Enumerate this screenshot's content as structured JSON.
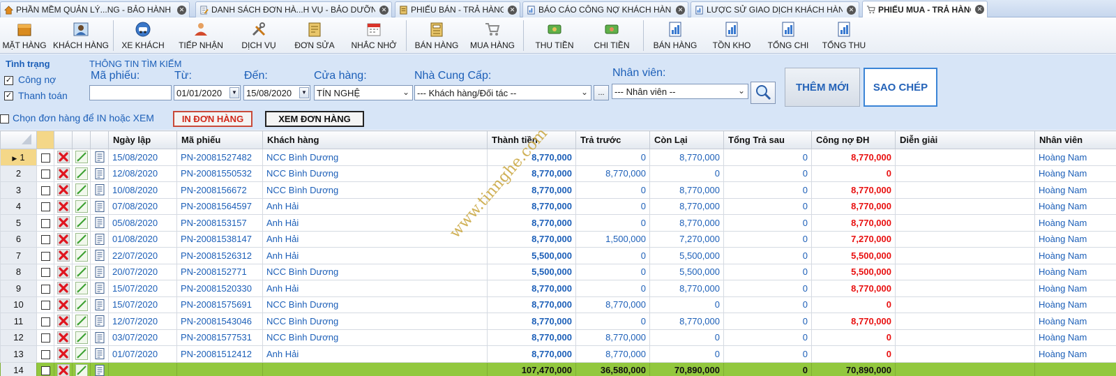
{
  "tabs": [
    {
      "label": "PHẦN MỀM QUẢN LÝ...NG - BẢO HÀNH XE",
      "icon": "home-icon",
      "active": false
    },
    {
      "label": "DANH SÁCH ĐƠN HÀ...H VỤ - BẢO DƯỠNG",
      "icon": "document-edit-icon",
      "active": false
    },
    {
      "label": "PHIẾU BÁN - TRẢ HÀNG",
      "icon": "invoice-icon",
      "active": false
    },
    {
      "label": "BÁO CÁO CÔNG NỢ KHÁCH HÀNG",
      "icon": "report-icon",
      "active": false
    },
    {
      "label": "LƯỢC SỬ GIAO DỊCH KHÁCH HÀNG",
      "icon": "report-icon",
      "active": false
    },
    {
      "label": "PHIẾU MUA - TRẢ HÀNG",
      "icon": "shopping-cart-icon",
      "active": true
    }
  ],
  "toolbar": [
    {
      "label": "MẶT HÀNG",
      "icon": "product-box-icon"
    },
    {
      "label": "KHÁCH HÀNG",
      "icon": "customer-icon"
    },
    {
      "label": "XE KHÁCH",
      "icon": "vehicle-icon"
    },
    {
      "label": "TIẾP NHẬN",
      "icon": "receptionist-icon"
    },
    {
      "label": "DỊCH VỤ",
      "icon": "tools-icon"
    },
    {
      "label": "ĐƠN SỬA",
      "icon": "repair-order-icon"
    },
    {
      "label": "NHẮC NHỞ",
      "icon": "calendar-icon"
    },
    {
      "label": "BÁN HÀNG",
      "icon": "cash-register-icon"
    },
    {
      "label": "MUA HÀNG",
      "icon": "shopping-cart-icon"
    },
    {
      "label": "THU TIỀN",
      "icon": "money-in-icon"
    },
    {
      "label": "CHI TIỀN",
      "icon": "money-out-icon"
    },
    {
      "label": "BÁN HÀNG",
      "icon": "sales-report-icon"
    },
    {
      "label": "TỒN KHO",
      "icon": "inventory-report-icon"
    },
    {
      "label": "TỔNG CHI",
      "icon": "expense-report-icon"
    },
    {
      "label": "TỔNG THU",
      "icon": "income-report-icon"
    }
  ],
  "status": {
    "title": "Tình trạng",
    "cong_no": {
      "label": "Công nợ",
      "checked": true
    },
    "thanh_toan": {
      "label": "Thanh toán",
      "checked": true
    }
  },
  "search": {
    "section_title": "THÔNG TIN TÌM KIẾM",
    "ma_phieu_label": "Mã phiếu:",
    "ma_phieu_value": "",
    "tu_label": "Từ:",
    "tu_value": "01/01/2020",
    "den_label": "Đến:",
    "den_value": "15/08/2020",
    "cua_hang_label": "Cửa hàng:",
    "cua_hang_value": "TÍN NGHỆ",
    "nha_cung_cap_label": "Nhà Cung Cấp:",
    "nha_cung_cap_value": "--- Khách hàng/Đối tác --",
    "nha_cung_cap_more": "...",
    "nhan_vien_label": "Nhân viên:",
    "nhan_vien_value": "--- Nhân viên --"
  },
  "buttons": {
    "them_moi": "THÊM MỚI",
    "sao_chep": "SAO CHÉP",
    "in_don_hang": "IN ĐƠN HÀNG",
    "xem_don_hang": "XEM ĐƠN HÀNG"
  },
  "select_print": {
    "label": "Chọn đơn hàng để IN hoặc XEM",
    "checked": false
  },
  "grid": {
    "headers": [
      "Ngày lập",
      "Mã phiếu",
      "Khách hàng",
      "Thành tiền",
      "Trả trước",
      "Còn Lại",
      "Tổng Trả sau",
      "Công nợ ĐH",
      "Diễn giải",
      "Nhân viên"
    ],
    "rows": [
      {
        "n": "1",
        "date": "15/08/2020",
        "code": "PN-20081527482",
        "customer": "NCC Bình Dương",
        "total": "8,770,000",
        "prepaid": "0",
        "remain": "8,770,000",
        "later": "0",
        "debt": "8,770,000",
        "note": "",
        "staff": "Hoàng Nam"
      },
      {
        "n": "2",
        "date": "12/08/2020",
        "code": "PN-20081550532",
        "customer": "NCC Bình Dương",
        "total": "8,770,000",
        "prepaid": "8,770,000",
        "remain": "0",
        "later": "0",
        "debt": "0",
        "note": "",
        "staff": "Hoàng Nam"
      },
      {
        "n": "3",
        "date": "10/08/2020",
        "code": "PN-2008156672",
        "customer": "NCC Bình Dương",
        "total": "8,770,000",
        "prepaid": "0",
        "remain": "8,770,000",
        "later": "0",
        "debt": "8,770,000",
        "note": "",
        "staff": "Hoàng Nam"
      },
      {
        "n": "4",
        "date": "07/08/2020",
        "code": "PN-20081564597",
        "customer": "Anh Hải",
        "total": "8,770,000",
        "prepaid": "0",
        "remain": "8,770,000",
        "later": "0",
        "debt": "8,770,000",
        "note": "",
        "staff": "Hoàng Nam"
      },
      {
        "n": "5",
        "date": "05/08/2020",
        "code": "PN-2008153157",
        "customer": "Anh Hải",
        "total": "8,770,000",
        "prepaid": "0",
        "remain": "8,770,000",
        "later": "0",
        "debt": "8,770,000",
        "note": "",
        "staff": "Hoàng Nam"
      },
      {
        "n": "6",
        "date": "01/08/2020",
        "code": "PN-20081538147",
        "customer": "Anh Hải",
        "total": "8,770,000",
        "prepaid": "1,500,000",
        "remain": "7,270,000",
        "later": "0",
        "debt": "7,270,000",
        "note": "",
        "staff": "Hoàng Nam"
      },
      {
        "n": "7",
        "date": "22/07/2020",
        "code": "PN-20081526312",
        "customer": "Anh Hải",
        "total": "5,500,000",
        "prepaid": "0",
        "remain": "5,500,000",
        "later": "0",
        "debt": "5,500,000",
        "note": "",
        "staff": "Hoàng Nam"
      },
      {
        "n": "8",
        "date": "20/07/2020",
        "code": "PN-2008152771",
        "customer": "NCC Bình Dương",
        "total": "5,500,000",
        "prepaid": "0",
        "remain": "5,500,000",
        "later": "0",
        "debt": "5,500,000",
        "note": "",
        "staff": "Hoàng Nam"
      },
      {
        "n": "9",
        "date": "15/07/2020",
        "code": "PN-20081520330",
        "customer": "Anh Hải",
        "total": "8,770,000",
        "prepaid": "0",
        "remain": "8,770,000",
        "later": "0",
        "debt": "8,770,000",
        "note": "",
        "staff": "Hoàng Nam"
      },
      {
        "n": "10",
        "date": "15/07/2020",
        "code": "PN-20081575691",
        "customer": "NCC Bình Dương",
        "total": "8,770,000",
        "prepaid": "8,770,000",
        "remain": "0",
        "later": "0",
        "debt": "0",
        "note": "",
        "staff": "Hoàng Nam"
      },
      {
        "n": "11",
        "date": "12/07/2020",
        "code": "PN-20081543046",
        "customer": "NCC Bình Dương",
        "total": "8,770,000",
        "prepaid": "0",
        "remain": "8,770,000",
        "later": "0",
        "debt": "8,770,000",
        "note": "",
        "staff": "Hoàng Nam"
      },
      {
        "n": "12",
        "date": "03/07/2020",
        "code": "PN-20081577531",
        "customer": "NCC Bình Dương",
        "total": "8,770,000",
        "prepaid": "8,770,000",
        "remain": "0",
        "later": "0",
        "debt": "0",
        "note": "",
        "staff": "Hoàng Nam"
      },
      {
        "n": "13",
        "date": "01/07/2020",
        "code": "PN-20081512412",
        "customer": "Anh Hải",
        "total": "8,770,000",
        "prepaid": "8,770,000",
        "remain": "0",
        "later": "0",
        "debt": "0",
        "note": "",
        "staff": "Hoàng Nam"
      }
    ],
    "total_row": {
      "n": "14",
      "total": "107,470,000",
      "prepaid": "36,580,000",
      "remain": "70,890,000",
      "later": "0",
      "debt": "70,890,000"
    }
  },
  "watermark": "www.tinnghe.com",
  "colors": {
    "accent_blue": "#1c5fb8",
    "debt_red": "#e81010",
    "total_green": "#92c83e",
    "selected_row": "#f4d788"
  }
}
